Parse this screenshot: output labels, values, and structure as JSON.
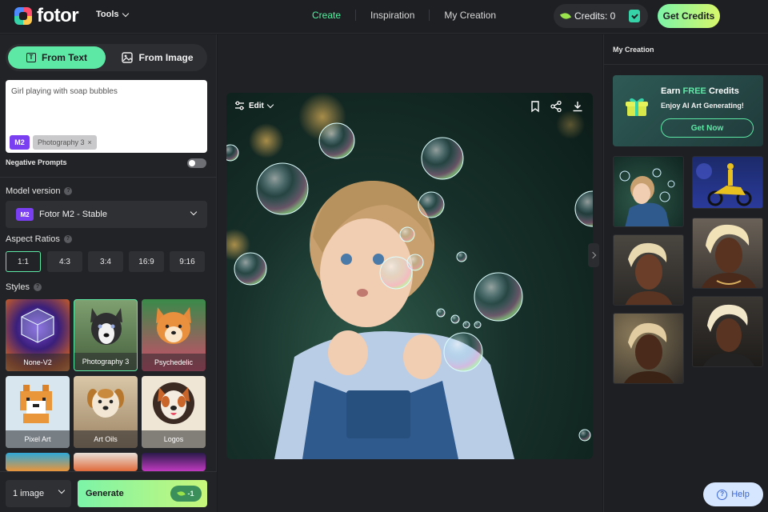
{
  "header": {
    "logo": "fotor",
    "tools_label": "Tools",
    "nav": [
      "Create",
      "Inspiration",
      "My Creation"
    ],
    "active_nav": "Create",
    "credits_label": "Credits: 0",
    "get_credits_label": "Get Credits"
  },
  "left_panel": {
    "mode_tabs": [
      "From Text",
      "From Image"
    ],
    "active_mode": "From Text",
    "prompt_value": "Girl playing with soap bubbles",
    "prompt_model_tag": "M2",
    "prompt_style_tag": "Photography 3",
    "negative_prompts_label": "Negative Prompts",
    "negative_prompts_enabled": false,
    "model_version_label": "Model version",
    "model_tag": "M2",
    "model_value": "Fotor M2 - Stable",
    "aspect_ratios_label": "Aspect Ratios",
    "aspect_ratios": [
      "1:1",
      "4:3",
      "3:4",
      "16:9",
      "9:16"
    ],
    "selected_ratio": "1:1",
    "styles_label": "Styles",
    "styles": [
      "None-V2",
      "Photography 3",
      "Psychedelic",
      "Pixel Art",
      "Art Oils",
      "Logos"
    ],
    "selected_style": "Photography 3",
    "image_count": "1 image",
    "generate_label": "Generate",
    "generate_cost": "-1"
  },
  "center": {
    "edit_label": "Edit"
  },
  "right_panel": {
    "title": "My Creation",
    "promo": {
      "earn": "Earn",
      "free": "FREE",
      "credits": "Credits",
      "subtitle": "Enjoy AI Art Generating!",
      "button": "Get Now"
    }
  },
  "help_label": "Help",
  "colors": {
    "accent": "#5ee8a6",
    "background": "#1b1c1f",
    "model_tag": "#7b3ff2",
    "help": "#3a67d8"
  }
}
